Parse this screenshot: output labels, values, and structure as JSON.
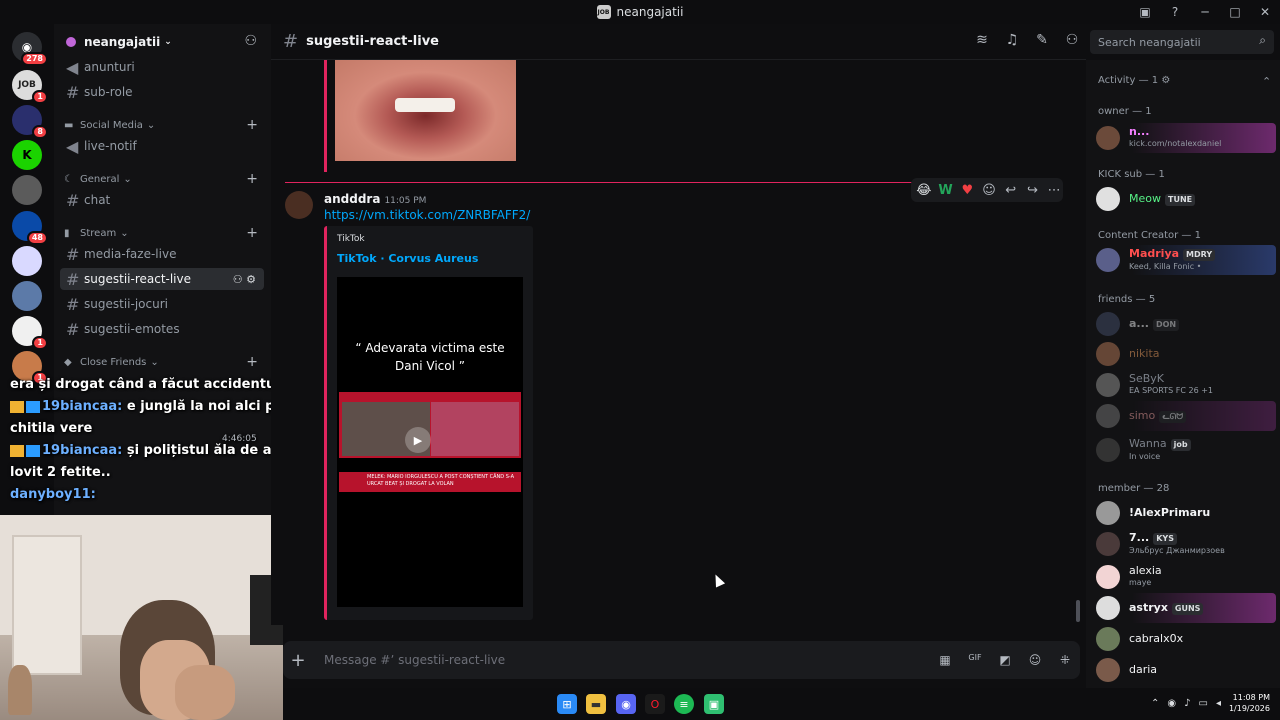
{
  "titlebar": {
    "title": "neangajatii",
    "logo": "JOB"
  },
  "rail": {
    "servers": [
      {
        "name": "discord-home",
        "badge": "278",
        "color": "#2b2d31"
      },
      {
        "name": "job-server",
        "badge": "1",
        "color": "#dcdcdc",
        "label": "JOB"
      },
      {
        "name": "server-3",
        "badge": "8",
        "color": "#2a2f6d"
      },
      {
        "name": "kick",
        "badge": "",
        "color": "#1bd300",
        "label": "K"
      },
      {
        "name": "server-5",
        "badge": "",
        "color": "#5b5b5b"
      },
      {
        "name": "server-6",
        "badge": "48",
        "color": "#0a4aa8"
      },
      {
        "name": "server-7",
        "badge": "",
        "color": "#d9d9ff"
      },
      {
        "name": "server-8",
        "badge": "",
        "color": "#5c7aa8"
      },
      {
        "name": "server-9",
        "badge": "1",
        "color": "#f0f0f0"
      },
      {
        "name": "server-10",
        "badge": "1",
        "color": "#c87b4a"
      }
    ]
  },
  "server": {
    "name": "neangajatii"
  },
  "channels": {
    "top": [
      {
        "icon": "megaphone-icon",
        "name": "anunturi"
      },
      {
        "icon": "hash-icon",
        "name": "sub-role"
      }
    ],
    "social_media": {
      "label": "Social Media",
      "items": [
        {
          "icon": "megaphone-icon",
          "name": "live-notif"
        }
      ]
    },
    "general": {
      "label": "General",
      "items": [
        {
          "icon": "hash-icon",
          "name": "chat"
        }
      ]
    },
    "stream": {
      "label": "Stream",
      "items": [
        {
          "name": "media-faze-live"
        },
        {
          "name": "sugestii-react-live",
          "active": true
        },
        {
          "name": "sugestii-jocuri"
        },
        {
          "name": "sugestii-emotes"
        }
      ]
    },
    "close_friends": {
      "label": "Close Friends"
    }
  },
  "overlay_chat": {
    "line1": "era și drogat când a făcut accidentul",
    "msg1_user": "19biancaa:",
    "msg1_text": "e junglă la noi alci pe chitila vere",
    "time": "4:46:05",
    "msg2_user": "19biancaa:",
    "msg2_text": "și polițistul ăla de a lovit 2 fetite..",
    "msg3_user": "danyboy11:"
  },
  "header": {
    "channel": "sugestii-react-live",
    "search_placeholder": "Search neangajatii"
  },
  "message": {
    "author": "andddra",
    "time": "11:05 PM",
    "link": "https://vm.tiktok.com/ZNRBFAFF2/",
    "embed_provider": "TikTok",
    "embed_title": "TikTok · Corvus Aureus",
    "video_caption_1": "“ Adevarata victima este",
    "video_caption_2": "Dani Vicol ”",
    "ticker": "MELEK: MARIO IORGULESCU A POST CONȘTIENT CÂND S-A URCAT BEAT ȘI DROGAT LA VOLAN"
  },
  "composer": {
    "placeholder": "Message #ʼ sugestii-react-live"
  },
  "members": {
    "activity": "Activity — 1",
    "owner": {
      "label": "owner — 1",
      "name": "n...",
      "status": "kick.com/notalexdaniel"
    },
    "kick": {
      "label": "KICK sub — 1",
      "name": "Meow",
      "tag": "TUNE"
    },
    "creator": {
      "label": "Content Creator — 1",
      "name": "Madriya",
      "tag": "MDRY",
      "status": "Keed, Killa Fonic •"
    },
    "friends": {
      "label": "friends — 5",
      "items": [
        {
          "name": "a...",
          "tag": "DON",
          "status": ""
        },
        {
          "name": "nikita",
          "tag": "",
          "status": ""
        },
        {
          "name": "SeByK",
          "tag": "",
          "status": "EA SPORTS FC 26 +1"
        },
        {
          "name": "simo",
          "tag": "ᓚᘏᗢ",
          "status": ""
        },
        {
          "name": "Wanna",
          "tag": "job",
          "status": "In voice"
        }
      ]
    },
    "member": {
      "label": "member — 28",
      "items": [
        {
          "name": "!AlexPrimaru",
          "tag": "",
          "status": ""
        },
        {
          "name": "7...",
          "tag": "KYS",
          "status": "Эльбрус Джанмирзоев"
        },
        {
          "name": "alexia",
          "tag": "",
          "status": "maye"
        },
        {
          "name": "astryx",
          "tag": "GUNS",
          "status": ""
        },
        {
          "name": "cabralx0x",
          "tag": "",
          "status": ""
        },
        {
          "name": "daria",
          "tag": "",
          "status": ""
        }
      ]
    }
  },
  "taskbar": {
    "time": "11:08 PM",
    "date": "1/19/2026"
  }
}
